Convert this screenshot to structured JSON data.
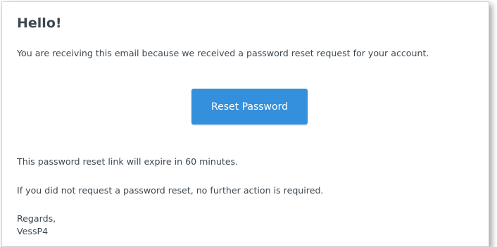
{
  "email": {
    "greeting": "Hello!",
    "intro_line": "You are receiving this email because we received a password reset request for your account.",
    "action_button_label": "Reset Password",
    "expiry_line": "This password reset link will expire in 60 minutes.",
    "no_action_line": "If you did not request a password reset, no further action is required.",
    "salutation": "Regards,",
    "sender_name": "VessP4"
  },
  "colors": {
    "button_background": "#3490dc",
    "button_text": "#ffffff",
    "body_text": "#3d4852"
  }
}
